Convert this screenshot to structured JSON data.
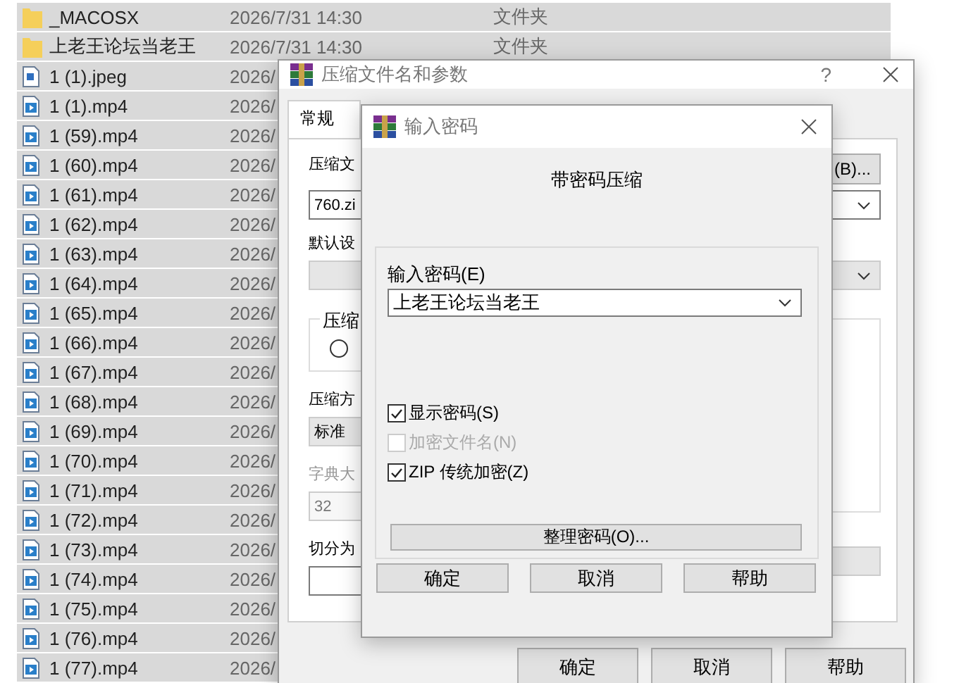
{
  "file_list": {
    "rows": [
      {
        "kind": "folder",
        "name": "_MACOSX",
        "date": "2026/7/31 14:30",
        "type": "文件夹",
        "selected": true
      },
      {
        "kind": "folder",
        "name": "上老王论坛当老王",
        "date": "2026/7/31 14:30",
        "type": "文件夹",
        "selected": true
      },
      {
        "kind": "image",
        "name": "1 (1).jpeg",
        "date": "2026/",
        "selected": true
      },
      {
        "kind": "video",
        "name": "1 (1).mp4",
        "date": "2026/",
        "selected": true
      },
      {
        "kind": "video",
        "name": "1 (59).mp4",
        "date": "2026/",
        "selected": true
      },
      {
        "kind": "video",
        "name": "1 (60).mp4",
        "date": "2026/",
        "selected": true
      },
      {
        "kind": "video",
        "name": "1 (61).mp4",
        "date": "2026/",
        "selected": true
      },
      {
        "kind": "video",
        "name": "1 (62).mp4",
        "date": "2026/",
        "selected": true
      },
      {
        "kind": "video",
        "name": "1 (63).mp4",
        "date": "2026/",
        "selected": true
      },
      {
        "kind": "video",
        "name": "1 (64).mp4",
        "date": "2026/",
        "selected": true
      },
      {
        "kind": "video",
        "name": "1 (65).mp4",
        "date": "2026/",
        "selected": true
      },
      {
        "kind": "video",
        "name": "1 (66).mp4",
        "date": "2026/",
        "selected": true
      },
      {
        "kind": "video",
        "name": "1 (67).mp4",
        "date": "2026/",
        "selected": true
      },
      {
        "kind": "video",
        "name": "1 (68).mp4",
        "date": "2026/",
        "selected": true
      },
      {
        "kind": "video",
        "name": "1 (69).mp4",
        "date": "2026/",
        "selected": true
      },
      {
        "kind": "video",
        "name": "1 (70).mp4",
        "date": "2026/",
        "selected": true
      },
      {
        "kind": "video",
        "name": "1 (71).mp4",
        "date": "2026/",
        "selected": true
      },
      {
        "kind": "video",
        "name": "1 (72).mp4",
        "date": "2026/",
        "selected": true
      },
      {
        "kind": "video",
        "name": "1 (73).mp4",
        "date": "2026/",
        "selected": true
      },
      {
        "kind": "video",
        "name": "1 (74).mp4",
        "date": "2026/",
        "selected": true
      },
      {
        "kind": "video",
        "name": "1 (75).mp4",
        "date": "2026/",
        "selected": true
      },
      {
        "kind": "video",
        "name": "1 (76).mp4",
        "date": "2026/",
        "selected": true
      },
      {
        "kind": "video",
        "name": "1 (77).mp4",
        "date": "2026/",
        "selected": true
      }
    ]
  },
  "archive_dialog": {
    "title": "压缩文件名和参数",
    "help": "?",
    "tabs": [
      {
        "label": "常规",
        "selected": true
      }
    ],
    "archive_name": {
      "label": "压缩文",
      "value": "760.zi"
    },
    "browse_button": "(B)...",
    "profile": {
      "label": "默认设"
    },
    "format_group": {
      "label": "压缩",
      "radio": {
        "selected": false
      }
    },
    "method": {
      "label": "压缩方",
      "value": "标准"
    },
    "dictionary": {
      "label": "字典大",
      "value": "32",
      "disabled": true
    },
    "split": {
      "label": "切分为"
    },
    "buttons": [
      "确定",
      "取消",
      "帮助"
    ]
  },
  "password_dialog": {
    "title": "输入密码",
    "heading": "带密码压缩",
    "password": {
      "label": "输入密码(E)",
      "value": "上老王论坛当老王"
    },
    "options": [
      {
        "label": "显示密码(S)",
        "checked": true,
        "disabled": false
      },
      {
        "label": "加密文件名(N)",
        "checked": false,
        "disabled": true
      },
      {
        "label": "ZIP 传统加密(Z)",
        "checked": true,
        "disabled": false
      }
    ],
    "organize_button": "整理密码(O)...",
    "buttons": [
      "确定",
      "取消",
      "帮助"
    ]
  }
}
